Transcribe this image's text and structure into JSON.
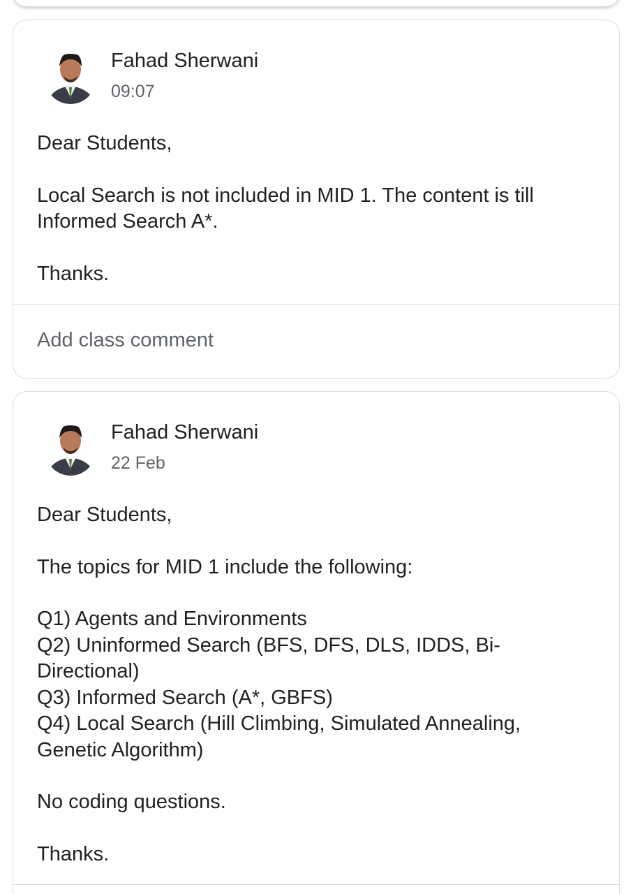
{
  "posts": [
    {
      "author": "Fahad Sherwani",
      "time": "09:07",
      "body": [
        "Dear Students,",
        "Local Search is not included in MID 1. The content is till Informed Search A*.",
        "Thanks."
      ],
      "comment_placeholder": "Add class comment"
    },
    {
      "author": "Fahad Sherwani",
      "time": "22 Feb",
      "body_intro": [
        "Dear Students,",
        "The topics for MID 1 include the following:"
      ],
      "topics": [
        "Q1) Agents and Environments",
        "Q2) Uninformed Search (BFS, DFS, DLS, IDDS, Bi-Directional)",
        "Q3) Informed Search (A*, GBFS)",
        "Q4) Local Search (Hill Climbing, Simulated Annealing, Genetic Algorithm)"
      ],
      "body_outro": [
        "No coding questions.",
        "Thanks."
      ]
    }
  ],
  "icons": {
    "avatar": "user-avatar-photo"
  },
  "colors": {
    "border": "#dadce0",
    "text": "#202124",
    "muted": "#5f6368"
  }
}
